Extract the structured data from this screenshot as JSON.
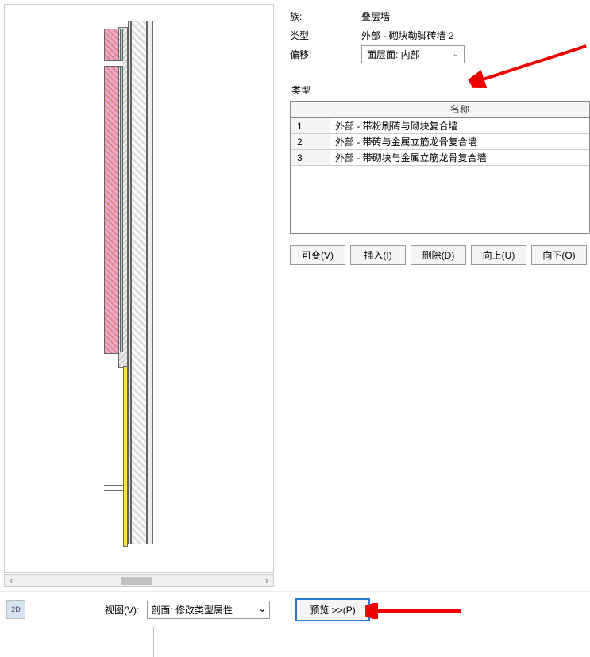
{
  "properties": {
    "family_label": "族:",
    "family_value": "叠层墙",
    "type_label": "类型:",
    "type_value": "外部 - 砌块勒脚砖墙 2",
    "offset_label": "偏移:",
    "offset_value": "面层面: 内部"
  },
  "type_section": {
    "header": "类型",
    "name_col": "名称",
    "rows": [
      {
        "num": "1",
        "name": "外部 - 带粉刷砖与砌块复合墙"
      },
      {
        "num": "2",
        "name": "外部 - 带砖与金属立筋龙骨复合墙"
      },
      {
        "num": "3",
        "name": "外部 - 带砌块与金属立筋龙骨复合墙"
      }
    ]
  },
  "buttons": {
    "variable": "可变(V)",
    "insert": "插入(I)",
    "delete": "删除(D)",
    "up": "向上(U)",
    "down": "向下(O)"
  },
  "bottom": {
    "icon2d": "2D",
    "view_label": "视图(V):",
    "view_value": "剖面: 修改类型属性",
    "preview": "预览 >>(P)"
  }
}
